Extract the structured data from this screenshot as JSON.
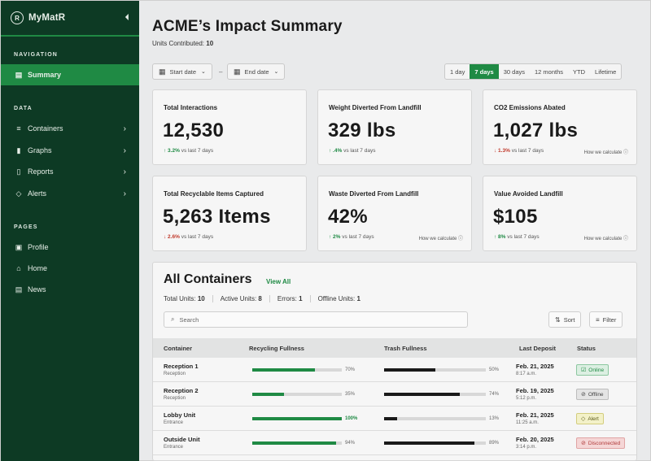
{
  "sidebar": {
    "brand": "MyMatR",
    "brand_logo_text": "R",
    "sections": {
      "navigation": "NAVIGATION",
      "data": "DATA",
      "pages": "PAGES"
    },
    "nav": [
      {
        "label": "Summary",
        "icon": "summary-icon",
        "active": true
      }
    ],
    "data_items": [
      {
        "label": "Containers",
        "icon": "list-icon"
      },
      {
        "label": "Graphs",
        "icon": "bar-chart-icon"
      },
      {
        "label": "Reports",
        "icon": "document-icon"
      },
      {
        "label": "Alerts",
        "icon": "diamond-icon"
      }
    ],
    "page_items": [
      {
        "label": "Profile",
        "icon": "profile-icon"
      },
      {
        "label": "Home",
        "icon": "home-icon"
      },
      {
        "label": "News",
        "icon": "news-icon"
      }
    ]
  },
  "header": {
    "title": "ACME’s Impact Summary",
    "units_label": "Units Contributed:",
    "units_value": "10"
  },
  "filters": {
    "start_date": "Start date",
    "end_date": "End date",
    "separator": "–",
    "ranges": [
      "1 day",
      "7 days",
      "30 days",
      "12 months",
      "YTD",
      "Lifetime"
    ],
    "active_range": "7 days"
  },
  "cards": [
    {
      "title": "Total Interactions",
      "value": "12,530",
      "delta": "↑ 3.2%",
      "direction": "up",
      "suffix": "vs last 7 days",
      "calc": ""
    },
    {
      "title": "Weight Diverted From Landfill",
      "value": "329 lbs",
      "delta": "↑ .4%",
      "direction": "up",
      "suffix": "vs last 7 days",
      "calc": ""
    },
    {
      "title": "CO2 Emissions Abated",
      "value": "1,027 lbs",
      "delta": "↓ 1.3%",
      "direction": "down",
      "suffix": "vs last 7 days",
      "calc": "How we calculate ⓘ"
    },
    {
      "title": "Total Recyclable Items Captured",
      "value": "5,263 Items",
      "delta": "↓ 2.6%",
      "direction": "down",
      "suffix": "vs last 7 days",
      "calc": ""
    },
    {
      "title": "Waste Diverted From Landfill",
      "value": "42%",
      "delta": "↑ 2%",
      "direction": "up",
      "suffix": "vs last 7 days",
      "calc": "How we calculate ⓘ"
    },
    {
      "title": "Value Avoided Landfill",
      "value": "$105",
      "delta": "↑ 8%",
      "direction": "up",
      "suffix": "vs last 7 days",
      "calc": "How we calculate ⓘ"
    }
  ],
  "containers": {
    "title": "All Containers",
    "view_all": "View All",
    "stats": [
      {
        "label": "Total Units:",
        "value": "10"
      },
      {
        "label": "Active Units:",
        "value": "8"
      },
      {
        "label": "Errors:",
        "value": "1"
      },
      {
        "label": "Offline Units:",
        "value": "1"
      }
    ],
    "search_placeholder": "Search",
    "sort_label": "Sort",
    "filter_label": "Filter",
    "columns": [
      "Container",
      "Recycling Fullness",
      "Trash Fullness",
      "Last Deposit",
      "Status"
    ],
    "rows": [
      {
        "name": "Reception 1",
        "location": "Reception",
        "recycling": 70,
        "recycling_label": "70%",
        "trash": 50,
        "trash_label": "50%",
        "date": "Feb. 21, 2025",
        "time": "8:17 a.m.",
        "status": "Online",
        "status_icon": "check-square-icon",
        "status_color": "#1f8a44",
        "status_bg": "#dcefe2",
        "status_border": "#8cc7a0"
      },
      {
        "name": "Reception 2",
        "location": "Reception",
        "recycling": 35,
        "recycling_label": "35%",
        "trash": 74,
        "trash_label": "74%",
        "date": "Feb. 19, 2025",
        "time": "5:12 p.m.",
        "status": "Offline",
        "status_icon": "wifi-off-icon",
        "status_color": "#444444",
        "status_bg": "#e4e4e4",
        "status_border": "#bdbdbd"
      },
      {
        "name": "Lobby Unit",
        "location": "Entrance",
        "recycling": 100,
        "recycling_label": "100%",
        "trash": 13,
        "trash_label": "13%",
        "date": "Feb. 21, 2025",
        "time": "11:25 a.m.",
        "status": "Alert",
        "status_icon": "diamond-icon",
        "status_color": "#5a5a1a",
        "status_bg": "#f3f1c8",
        "status_border": "#d3cd7e"
      },
      {
        "name": "Outside Unit",
        "location": "Entrance",
        "recycling": 94,
        "recycling_label": "94%",
        "trash": 89,
        "trash_label": "89%",
        "date": "Feb. 20, 2025",
        "time": "3:14 p.m.",
        "status": "Disconnected",
        "status_icon": "wifi-off-icon",
        "status_color": "#b03a3a",
        "status_bg": "#f5d6d6",
        "status_border": "#e0a4a4"
      }
    ]
  },
  "colors": {
    "sidebar_bg": "#0d3a24",
    "accent": "#1f8a44",
    "trash_bar": "#1a1a1a"
  }
}
